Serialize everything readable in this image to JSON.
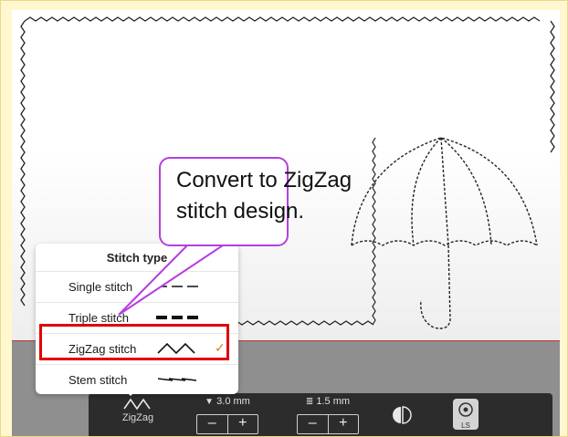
{
  "colors": {
    "canvas_bg": "#ffffff",
    "frame_bg": "#fff7cf",
    "highlight_border": "#e00000",
    "callout_border": "#b53fe0",
    "check_color": "#e07d1a",
    "toolbar_bg": "#2c2c2c"
  },
  "callout": {
    "text_line1": "Convert to ZigZag",
    "text_line2": "stitch design."
  },
  "stitch_menu": {
    "title": "Stitch type",
    "items": [
      {
        "label": "Single stitch",
        "sample_icon": "single-line-icon",
        "selected": false
      },
      {
        "label": "Triple stitch",
        "sample_icon": "triple-line-icon",
        "selected": false
      },
      {
        "label": "ZigZag stitch",
        "sample_icon": "zigzag-icon",
        "selected": true
      },
      {
        "label": "Stem stitch",
        "sample_icon": "stem-line-icon",
        "selected": false
      }
    ],
    "check_glyph": "✓"
  },
  "toolbar": {
    "stitch_label": "ZigZag",
    "width": {
      "value": "3.0 mm",
      "minus": "–",
      "plus": "+",
      "icon": "width-icon"
    },
    "length": {
      "value": "1.5 mm",
      "minus": "–",
      "plus": "+",
      "icon": "length-icon"
    },
    "mirror_icon": "mirror-icon",
    "ls_label": "LS"
  }
}
